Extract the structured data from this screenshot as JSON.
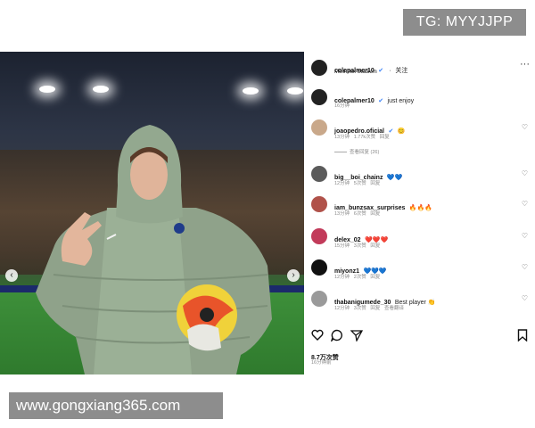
{
  "watermarks": {
    "top": "TG: MYYJJPP",
    "bottom": "www.gongxiang365.com"
  },
  "post": {
    "username": "colepalmer10",
    "follow_label": "关注",
    "location": "Molineux Stadium",
    "caption_user": "colepalmer10",
    "caption_text": "just enjoy",
    "caption_time": "16分钟",
    "more_icon": "more-horizontal-icon"
  },
  "comments": [
    {
      "user": "joaopedro.oficial",
      "text": "😊",
      "time": "13分钟",
      "likes": "1.77k次赞",
      "reply": "回复",
      "view_replies": "查看回复 (26)"
    },
    {
      "user": "big__boi_chainz",
      "text": "💙💙",
      "time": "12分钟",
      "likes": "5次赞",
      "reply": "回复"
    },
    {
      "user": "iam_bunzsax_surprises",
      "text": "🔥🔥🔥",
      "time": "13分钟",
      "likes": "6次赞",
      "reply": "回复"
    },
    {
      "user": "delex_02",
      "text": "❤️❤️❤️",
      "time": "15分钟",
      "likes": "3次赞",
      "reply": "回复"
    },
    {
      "user": "miyonz1",
      "text": "💙💙💙",
      "time": "12分钟",
      "likes": "2次赞",
      "reply": "回复"
    },
    {
      "user": "thabanigumede_30",
      "text": "Best player 👏",
      "time": "12分钟",
      "likes": "3次赞",
      "reply": "回复",
      "translate": "查看翻译"
    }
  ],
  "footer": {
    "likes": "8.7万次赞",
    "time": "16分钟前"
  },
  "colors": {
    "verified": "#3b82f6",
    "watermark_bg": "#8d8d8d"
  }
}
